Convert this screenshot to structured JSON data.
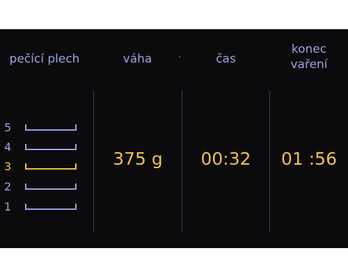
{
  "headers": {
    "tray": "pečící plech",
    "weight": "váha",
    "time": "čas",
    "end_line1": "konec",
    "end_line2": "vaření"
  },
  "trays": [
    {
      "number": "5",
      "active": false
    },
    {
      "number": "4",
      "active": false
    },
    {
      "number": "3",
      "active": true
    },
    {
      "number": "2",
      "active": false
    },
    {
      "number": "1",
      "active": false
    }
  ],
  "values": {
    "weight": "375 g",
    "time": "00:32",
    "end": "01 :56"
  },
  "colors": {
    "background": "#0b0b0d",
    "label": "#9aa3df",
    "highlight": "#f0c050",
    "divider": "#3b3d55"
  }
}
